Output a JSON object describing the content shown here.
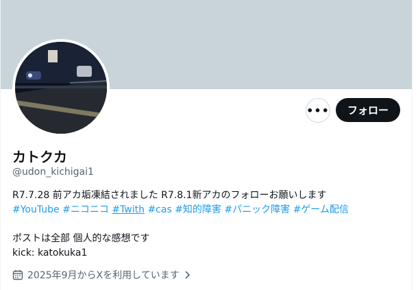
{
  "profile": {
    "display_name": "カトクカ",
    "handle": "@udon_kichigai1",
    "bio_line1": "R7.7.28 前アカ垢凍結されました R7.8.1新アカのフォローお願いします",
    "hashtags": [
      "#YouTube",
      "#ニコニコ",
      "#Twith",
      "#cas",
      "#知的障害",
      "#パニック障害",
      "#ゲーム配信"
    ],
    "bio_line3": "ポストは全部 個人的な感想です",
    "bio_line4": "kick: katokuka1",
    "joined": "2025年9月からXを利用しています"
  },
  "actions": {
    "more_label": "•••",
    "follow_label": "フォロー"
  },
  "colors": {
    "banner": "#c8d4da",
    "link": "#1d9bf0",
    "button_dark": "#0f1419",
    "secondary_text": "#536471"
  },
  "icons": {
    "calendar": "calendar-icon",
    "chevron": "chevron-right-icon",
    "more": "more-icon"
  }
}
